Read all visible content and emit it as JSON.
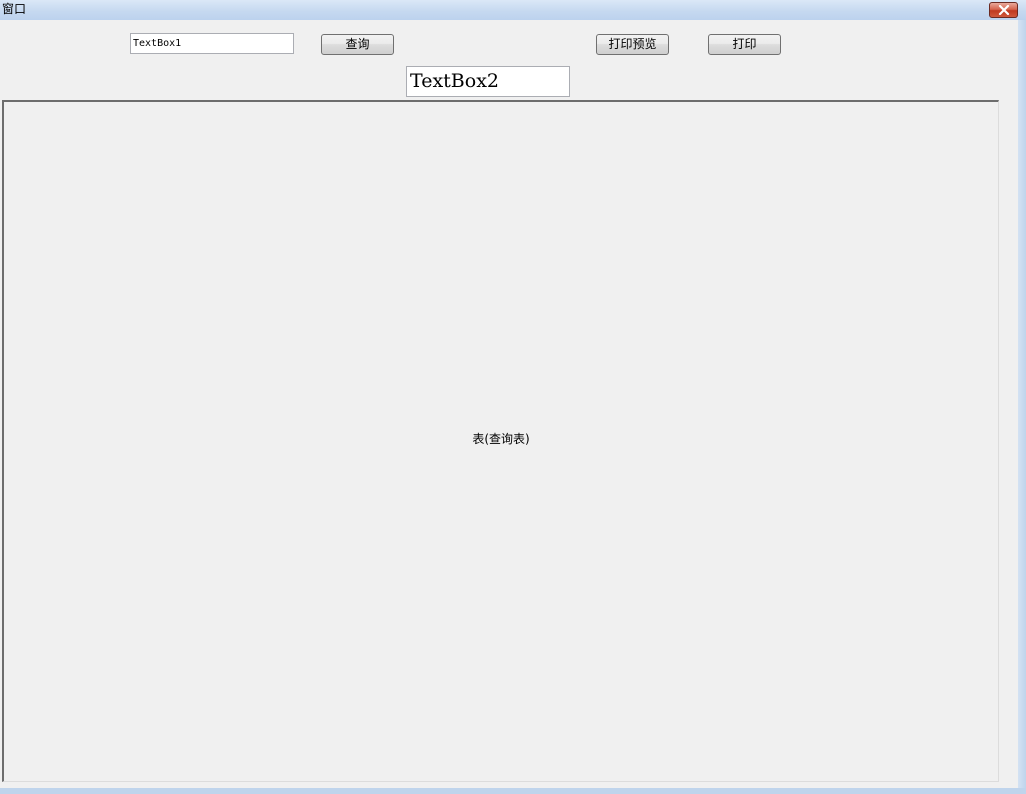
{
  "window": {
    "title": "窗口"
  },
  "toolbar": {
    "textbox1_value": "TextBox1",
    "query_label": "查询",
    "print_preview_label": "打印预览",
    "print_label": "打印"
  },
  "textbox2_value": "TextBox2",
  "table": {
    "label": "表(查询表)"
  },
  "colors": {
    "close_button": "#c0391f",
    "client_background": "#f0f0f0",
    "frame": "#c3d7ee"
  }
}
